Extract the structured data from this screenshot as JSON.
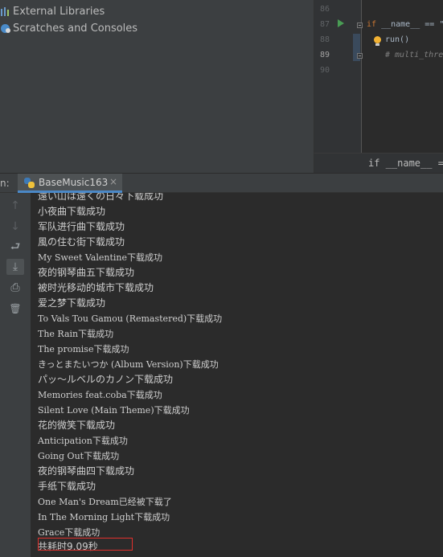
{
  "project_tree": {
    "items": [
      {
        "label": "External Libraries",
        "icon": "library-icon"
      },
      {
        "label": "Scratches and Consoles",
        "icon": "scratches-icon"
      }
    ]
  },
  "editor": {
    "line_numbers": [
      "86",
      "87",
      "88",
      "89",
      "90"
    ],
    "current_line": "89",
    "code": {
      "line87_kw": "if",
      "line87_rest": " __name__ == \"",
      "line88": "run()",
      "line89": "# multi_thre"
    },
    "breadcrumb": "if __name__ == '"
  },
  "run_window": {
    "label": "n:",
    "tab_label": "BaseMusic163",
    "tab_close": "×"
  },
  "toolbar": {
    "up_icon": "↑",
    "down_icon": "↓",
    "wrap_icon": "⮐",
    "scroll_end_icon": "⤓",
    "print_icon": "⎙",
    "trash_icon": "🗑"
  },
  "console": {
    "lines": [
      "遠い山は遠くの日々下载成功",
      "小夜曲下载成功",
      "军队进行曲下载成功",
      "風の住む街下载成功",
      "My Sweet Valentine下载成功",
      "夜的钢琴曲五下载成功",
      "被时光移动的城市下载成功",
      "爱之梦下载成功",
      "To Vals Tou Gamou (Remastered)下载成功",
      "The Rain下载成功",
      "The promise下载成功",
      "きっとまたいつか (Album Version)下载成功",
      "パッ～ルベルのカノン下载成功",
      "Memories feat.coba下载成功",
      "Silent Love (Main Theme)下载成功",
      "花的微笑下载成功",
      "Anticipation下载成功",
      "Going Out下载成功",
      "夜的钢琴曲四下载成功",
      "手纸下载成功",
      "One Man's Dream已经被下载了",
      "In The Morning Light下载成功",
      "Grace下载成功",
      "共耗时9.09秒"
    ]
  },
  "colors": {
    "highlight_border": "#e0302d",
    "run_icon": "#499c54",
    "keyword": "#cc7832"
  }
}
